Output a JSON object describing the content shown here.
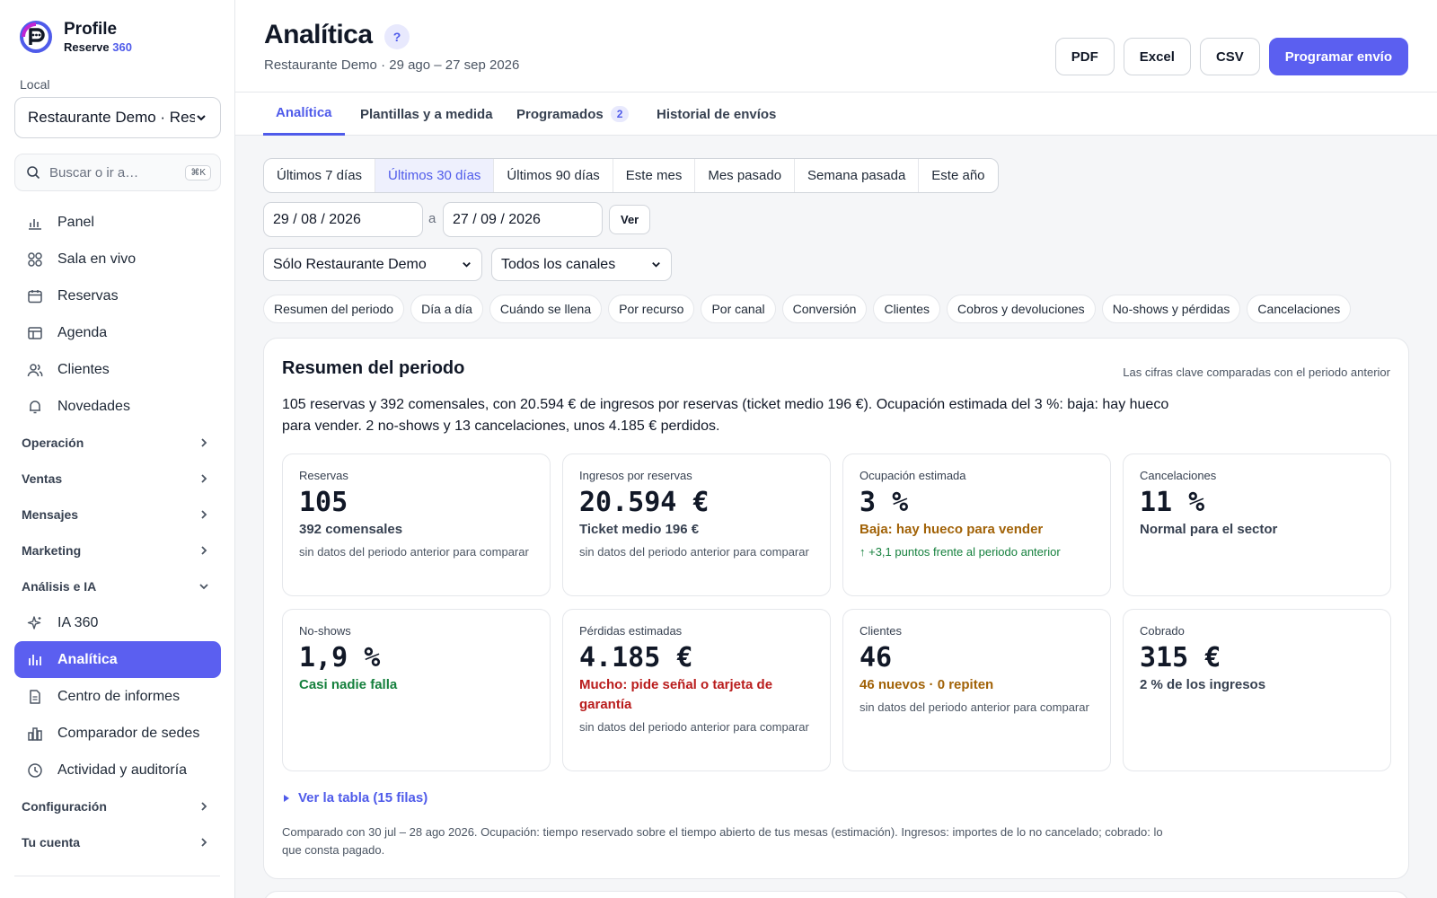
{
  "brand": {
    "name": "Profile",
    "sub_main": "Reserve",
    "sub_accent": "360"
  },
  "sidebar": {
    "local_label": "Local",
    "local_value": "Restaurante Demo · Res",
    "search_placeholder": "Buscar o ir a…",
    "search_shortcut": "⌘K",
    "items": [
      {
        "label": "Panel",
        "icon": "bar-chart-icon"
      },
      {
        "label": "Sala en vivo",
        "icon": "grid-icon"
      },
      {
        "label": "Reservas",
        "icon": "calendar-icon"
      },
      {
        "label": "Agenda",
        "icon": "table-icon"
      },
      {
        "label": "Clientes",
        "icon": "users-icon"
      },
      {
        "label": "Novedades",
        "icon": "bell-icon"
      }
    ],
    "groups_top": [
      "Operación",
      "Ventas",
      "Mensajes",
      "Marketing"
    ],
    "analysis_group": "Análisis e IA",
    "analysis_items": [
      {
        "label": "IA 360",
        "icon": "sparkle-icon"
      },
      {
        "label": "Analítica",
        "icon": "analytics-icon",
        "active": true
      },
      {
        "label": "Centro de informes",
        "icon": "document-icon"
      },
      {
        "label": "Comparador de sedes",
        "icon": "compare-icon"
      },
      {
        "label": "Actividad y auditoría",
        "icon": "clock-icon"
      }
    ],
    "groups_bottom": [
      "Configuración",
      "Tu cuenta"
    ]
  },
  "header": {
    "title": "Analítica",
    "help": "?",
    "subtitle": "Restaurante Demo · 29 ago – 27 sep 2026",
    "buttons": {
      "pdf": "PDF",
      "excel": "Excel",
      "csv": "CSV",
      "schedule": "Programar envío"
    }
  },
  "tabs": [
    {
      "label": "Analítica",
      "active": true
    },
    {
      "label": "Plantillas y a medida"
    },
    {
      "label": "Programados",
      "badge": "2"
    },
    {
      "label": "Historial de envíos"
    }
  ],
  "periods": [
    "Últimos 7 días",
    "Últimos 30 días",
    "Últimos 90 días",
    "Este mes",
    "Mes pasado",
    "Semana pasada",
    "Este año"
  ],
  "selected_period": "Últimos 30 días",
  "date_from": "29 / 08 / 2026",
  "date_to": "27 / 09 / 2026",
  "date_sep": "a",
  "view_button": "Ver",
  "venue_filter": "Sólo Restaurante Demo",
  "channel_filter": "Todos los canales",
  "sections": [
    "Resumen del periodo",
    "Día a día",
    "Cuándo se llena",
    "Por recurso",
    "Por canal",
    "Conversión",
    "Clientes",
    "Cobros y devoluciones",
    "No-shows y pérdidas",
    "Cancelaciones"
  ],
  "summary": {
    "title": "Resumen del periodo",
    "note": "Las cifras clave comparadas con el periodo anterior",
    "text": "105 reservas y 392 comensales, con 20.594 € de ingresos por reservas (ticket medio 196 €). Ocupación estimada del 3 %: baja: hay hueco para vender. 2 no-shows y 13 cancelaciones, unos 4.185 € perdidos.",
    "kpis": [
      {
        "label": "Reservas",
        "value": "105",
        "sub": "392 comensales",
        "sub_tone": "neutral",
        "note": "sin datos del periodo anterior para comparar"
      },
      {
        "label": "Ingresos por reservas",
        "value": "20.594 €",
        "sub": "Ticket medio 196 €",
        "sub_tone": "neutral",
        "note": "sin datos del periodo anterior para comparar"
      },
      {
        "label": "Ocupación estimada",
        "value": "3 %",
        "sub": "Baja: hay hueco para vender",
        "sub_tone": "warn",
        "note": "↑ +3,1 puntos frente al periodo anterior",
        "note_tone": "up"
      },
      {
        "label": "Cancelaciones",
        "value": "11 %",
        "sub": "Normal para el sector",
        "sub_tone": "neutral",
        "note": ""
      },
      {
        "label": "No-shows",
        "value": "1,9 %",
        "sub": "Casi nadie falla",
        "sub_tone": "good",
        "note": ""
      },
      {
        "label": "Pérdidas estimadas",
        "value": "4.185 €",
        "sub": "Mucho: pide señal o tarjeta de garantía",
        "sub_tone": "bad",
        "note": "sin datos del periodo anterior para comparar"
      },
      {
        "label": "Clientes",
        "value": "46",
        "sub": "46 nuevos · 0 repiten",
        "sub_tone": "warn",
        "note": "sin datos del periodo anterior para comparar"
      },
      {
        "label": "Cobrado",
        "value": "315 €",
        "sub": "2 % de los ingresos",
        "sub_tone": "neutral",
        "note": ""
      }
    ],
    "table_toggle": "Ver la tabla (15 filas)",
    "footnote": "Comparado con 30 jul – 28 ago 2026. Ocupación: tiempo reservado sobre el tiempo abierto de tus mesas (estimación). Ingresos: importes de lo no cancelado; cobrado: lo que consta pagado."
  },
  "colors": {
    "accent": "#5b5ff0",
    "warn": "#a16207",
    "good": "#15803d",
    "bad": "#b91c1c"
  }
}
